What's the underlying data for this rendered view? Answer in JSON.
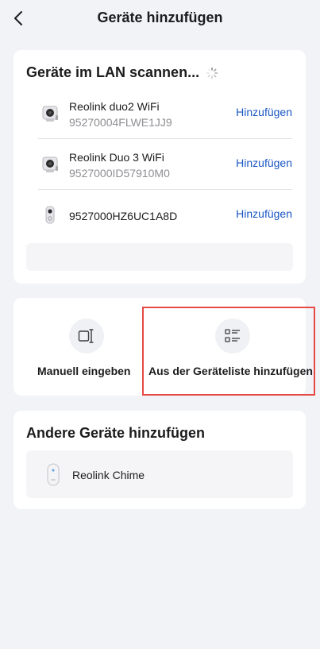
{
  "header": {
    "title": "Geräte hinzufügen",
    "back_icon": "chevron-left-icon"
  },
  "lan": {
    "title": "Geräte im LAN scannen...",
    "devices": [
      {
        "name": "Reolink duo2 WiFi",
        "serial": "95270004FLWE1JJ9",
        "action": "Hinzufügen",
        "icon": "dual-camera-icon"
      },
      {
        "name": "Reolink Duo 3 WiFi",
        "serial": "9527000ID57910M0",
        "action": "Hinzufügen",
        "icon": "dual-camera-icon"
      },
      {
        "name": "9527000HZ6UC1A8D",
        "serial": "",
        "action": "Hinzufügen",
        "icon": "doorbell-icon"
      }
    ]
  },
  "actions": {
    "manual": {
      "label": "Manuell eingeben",
      "icon": "manual-input-icon"
    },
    "from_list": {
      "label": "Aus der Geräteliste hinzufügen",
      "icon": "device-list-icon"
    }
  },
  "other": {
    "title": "Andere Geräte hinzufügen",
    "items": [
      {
        "label": "Reolink Chime",
        "icon": "chime-icon"
      }
    ]
  },
  "colors": {
    "accent": "#1a56c4",
    "highlight_border": "#e54a44",
    "background": "#f2f3f7"
  }
}
